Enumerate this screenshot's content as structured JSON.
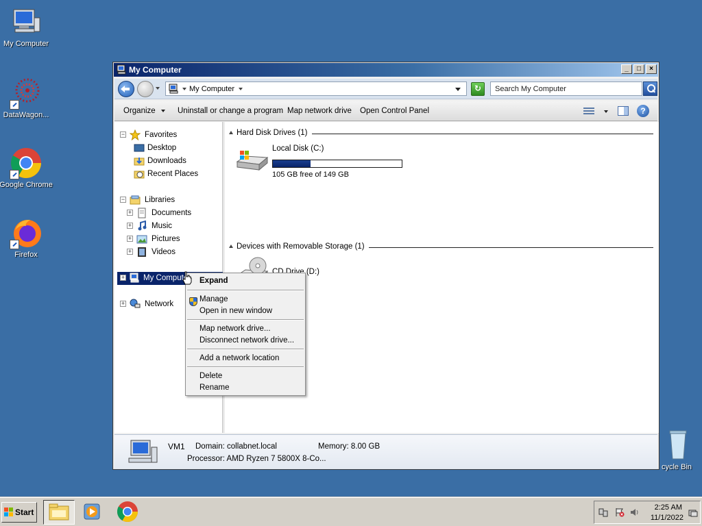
{
  "desktop": {
    "icons": [
      {
        "label": "My Computer",
        "icon": "my-computer-icon"
      },
      {
        "label": "DataWagon...",
        "icon": "datawagon-icon"
      },
      {
        "label": "Google Chrome",
        "icon": "chrome-icon"
      },
      {
        "label": "Firefox",
        "icon": "firefox-icon"
      },
      {
        "label": "cycle Bin",
        "icon": "recycle-bin-icon"
      }
    ]
  },
  "window": {
    "title": "My Computer",
    "controls": {
      "minimize": "_",
      "maximize": "□",
      "close": "×"
    },
    "address": {
      "crumb": "My Computer"
    },
    "search": {
      "placeholder": "Search My Computer"
    },
    "commands": {
      "organize": "Organize",
      "uninstall": "Uninstall or change a program",
      "map_drive": "Map network drive",
      "control_panel": "Open Control Panel"
    },
    "nav": {
      "favorites": "Favorites",
      "desktop": "Desktop",
      "downloads": "Downloads",
      "recent": "Recent Places",
      "libraries": "Libraries",
      "documents": "Documents",
      "music": "Music",
      "pictures": "Pictures",
      "videos": "Videos",
      "my_computer": "My Computer",
      "network": "Network"
    },
    "groups": {
      "hard_disk": "Hard Disk Drives (1)",
      "removable": "Devices with Removable Storage (1)"
    },
    "drives": {
      "c": {
        "name": "Local Disk (C:)",
        "free": "105 GB free of 149 GB",
        "used_fraction": 0.295
      },
      "d": {
        "name": "CD Drive (D:)"
      }
    },
    "details": {
      "name": "VM1",
      "domain": "Domain: collabnet.local",
      "memory": "Memory: 8.00 GB",
      "processor": "Processor: AMD Ryzen 7 5800X 8-Co..."
    }
  },
  "context_menu": {
    "expand": "Expand",
    "manage": "Manage",
    "open_new": "Open in new window",
    "map_drive": "Map network drive...",
    "disconnect": "Disconnect network drive...",
    "add_location": "Add a network location",
    "delete": "Delete",
    "rename": "Rename"
  },
  "taskbar": {
    "start": "Start",
    "time": "2:25 AM",
    "date": "11/1/2022"
  },
  "colors": {
    "desktop": "#3a6ea5",
    "selection": "#0a246a",
    "title_start": "#0a246a",
    "title_end": "#a6caf0"
  }
}
